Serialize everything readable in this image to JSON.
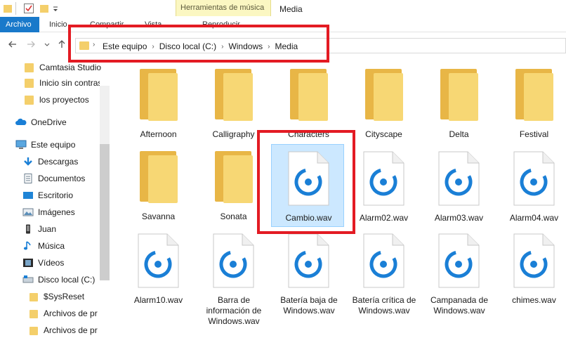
{
  "title_bar": {
    "contextual_tab": "Herramientas de música",
    "window_title": "Media"
  },
  "ribbon": {
    "file_tab": "Archivo",
    "tabs": [
      "Inicio",
      "Compartir",
      "Vista",
      "Reproducir"
    ]
  },
  "address": {
    "crumbs": [
      "Este equipo",
      "Disco local (C:)",
      "Windows",
      "Media"
    ]
  },
  "sidebar": {
    "items": [
      {
        "label": "Camtasia Studio",
        "icon": "folder-icon"
      },
      {
        "label": "Inicio sin contras",
        "icon": "folder-icon"
      },
      {
        "label": "los proyectos",
        "icon": "folder-icon"
      },
      {
        "label": "OneDrive",
        "icon": "cloud-icon"
      },
      {
        "label": "Este equipo",
        "icon": "computer-icon"
      },
      {
        "label": "Descargas",
        "icon": "downloads-icon"
      },
      {
        "label": "Documentos",
        "icon": "documents-icon"
      },
      {
        "label": "Escritorio",
        "icon": "desktop-icon"
      },
      {
        "label": "Imágenes",
        "icon": "pictures-icon"
      },
      {
        "label": "Juan",
        "icon": "phone-icon"
      },
      {
        "label": "Música",
        "icon": "music-icon"
      },
      {
        "label": "Vídeos",
        "icon": "videos-icon"
      },
      {
        "label": "Disco local (C:)",
        "icon": "drive-icon"
      },
      {
        "label": "$SysReset",
        "icon": "folder-icon"
      },
      {
        "label": "Archivos de pr",
        "icon": "folder-icon"
      },
      {
        "label": "Archivos de pr",
        "icon": "folder-icon"
      }
    ]
  },
  "files": [
    {
      "name": "Afternoon",
      "type": "folder"
    },
    {
      "name": "Calligraphy",
      "type": "folder"
    },
    {
      "name": "Characters",
      "type": "folder"
    },
    {
      "name": "Cityscape",
      "type": "folder"
    },
    {
      "name": "Delta",
      "type": "folder"
    },
    {
      "name": "Festival",
      "type": "folder"
    },
    {
      "name": "Savanna",
      "type": "folder"
    },
    {
      "name": "Sonata",
      "type": "folder"
    },
    {
      "name": "Cambio.wav",
      "type": "audio",
      "selected": true
    },
    {
      "name": "Alarm02.wav",
      "type": "audio"
    },
    {
      "name": "Alarm03.wav",
      "type": "audio"
    },
    {
      "name": "Alarm04.wav",
      "type": "audio"
    },
    {
      "name": "Alarm10.wav",
      "type": "audio"
    },
    {
      "name": "Barra de información de Windows.wav",
      "type": "audio"
    },
    {
      "name": "Batería baja de Windows.wav",
      "type": "audio"
    },
    {
      "name": "Batería crítica de Windows.wav",
      "type": "audio"
    },
    {
      "name": "Campanada de Windows.wav",
      "type": "audio"
    },
    {
      "name": "chimes.wav",
      "type": "audio"
    }
  ],
  "colors": {
    "file_tab": "#1979ca",
    "folder": "#f4cf6b",
    "audio_icon": "#1a7fd6",
    "selection": "#cce8ff",
    "highlight_box": "#e31b23",
    "contextual_tab": "#fbf7c2"
  }
}
